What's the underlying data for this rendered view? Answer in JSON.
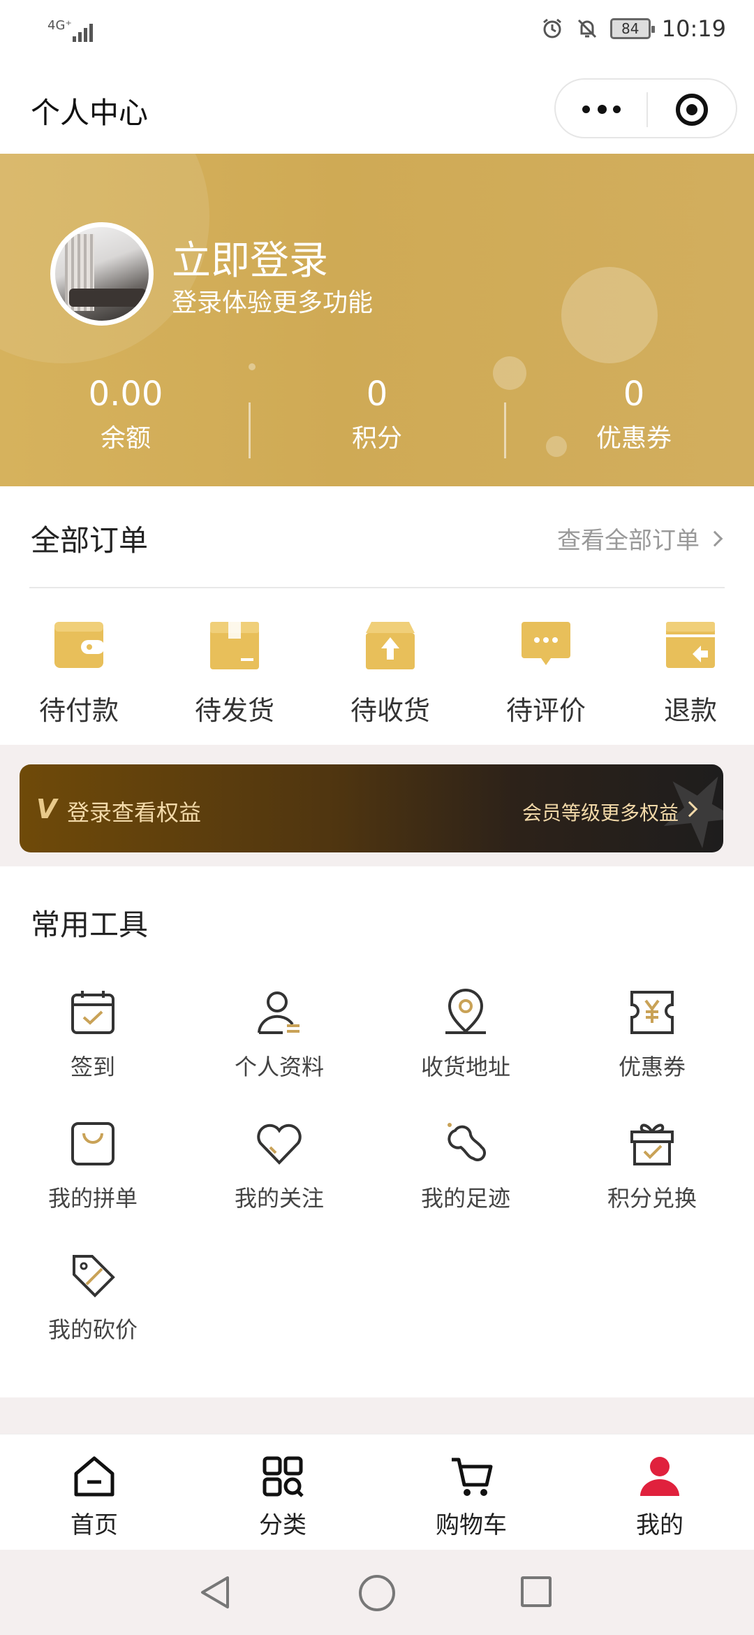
{
  "status_bar": {
    "network": "4G⁺",
    "battery": "84",
    "time": "10:19",
    "icons": [
      "alarm-icon",
      "bell-off-icon"
    ]
  },
  "title_bar": {
    "title": "个人中心",
    "capsule_icons": [
      "more-icon",
      "target-icon"
    ]
  },
  "profile": {
    "login_title": "立即登录",
    "login_subtitle": "登录体验更多功能",
    "stats": [
      {
        "value": "0.00",
        "label": "余额"
      },
      {
        "value": "0",
        "label": "积分"
      },
      {
        "value": "0",
        "label": "优惠券"
      }
    ]
  },
  "orders": {
    "title": "全部订单",
    "view_all": "查看全部订单",
    "items": [
      {
        "label": "待付款",
        "icon": "wallet-icon"
      },
      {
        "label": "待发货",
        "icon": "box-icon"
      },
      {
        "label": "待收货",
        "icon": "box-arrow-up-icon"
      },
      {
        "label": "待评价",
        "icon": "chat-bubble-icon"
      },
      {
        "label": "退款",
        "icon": "refund-icon"
      }
    ]
  },
  "member": {
    "badge": "V",
    "text": "登录查看权益",
    "link": "会员等级更多权益"
  },
  "tools": {
    "title": "常用工具",
    "items": [
      {
        "label": "签到",
        "icon": "calendar-check-icon"
      },
      {
        "label": "个人资料",
        "icon": "user-icon"
      },
      {
        "label": "收货地址",
        "icon": "location-pin-icon"
      },
      {
        "label": "优惠券",
        "icon": "coupon-yen-icon"
      },
      {
        "label": "我的拼单",
        "icon": "shopping-bag-icon"
      },
      {
        "label": "我的关注",
        "icon": "heart-icon"
      },
      {
        "label": "我的足迹",
        "icon": "footprint-icon"
      },
      {
        "label": "积分兑换",
        "icon": "gift-icon"
      },
      {
        "label": "我的砍价",
        "icon": "price-tag-icon"
      }
    ]
  },
  "tabbar": {
    "items": [
      {
        "label": "首页",
        "icon": "home-icon"
      },
      {
        "label": "分类",
        "icon": "category-icon"
      },
      {
        "label": "购物车",
        "icon": "cart-icon"
      },
      {
        "label": "我的",
        "icon": "profile-icon"
      }
    ],
    "active": "我的",
    "accent_color": "#e0213d"
  },
  "colors": {
    "gold": "#d1ad5a",
    "order_icon": "#e8bf5a",
    "tool_accent": "#c9a257",
    "member_text": "#f2d9a9"
  }
}
